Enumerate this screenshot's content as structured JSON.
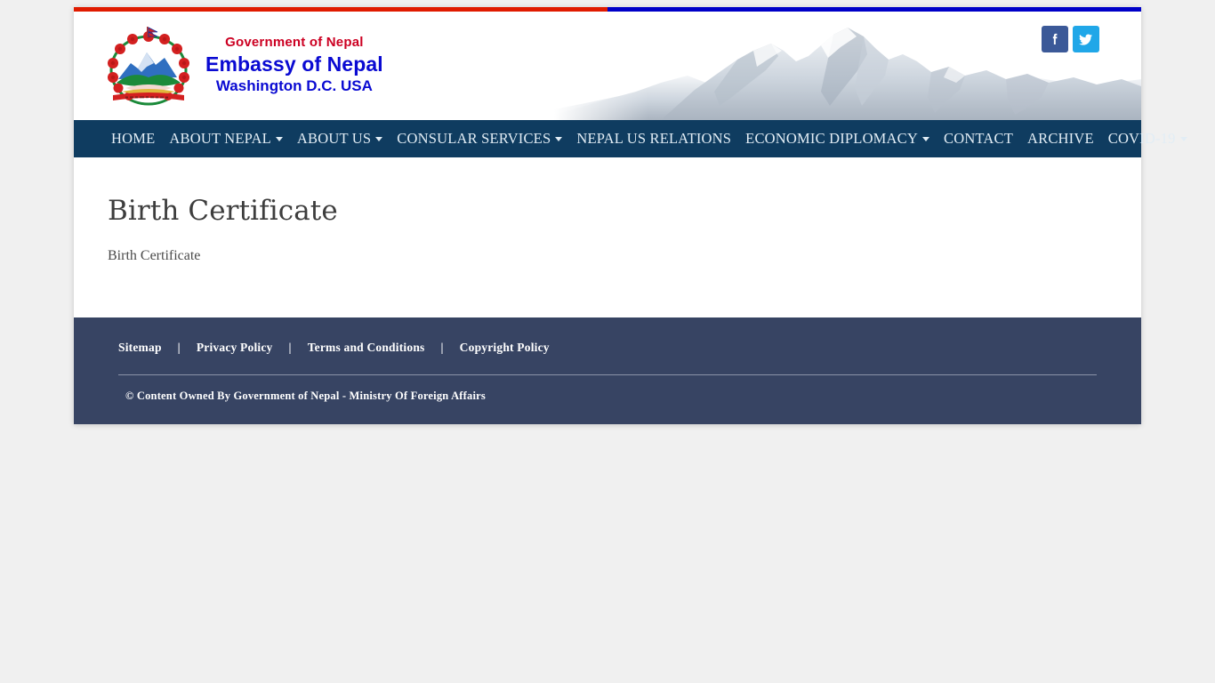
{
  "theme": {
    "stripe_red": "#e01b00",
    "stripe_blue": "#0000c8",
    "nav_bg": "#0f3c60",
    "nav_text": "#e2edf5",
    "footer_bg": "#374463",
    "brand_red": "#cc0022",
    "brand_blue": "#0a0ad2",
    "facebook_blue": "#3b5998",
    "twitter_blue": "#20a7e8",
    "page_bg": "#f0f0f0"
  },
  "header": {
    "emblem_alt": "coat-of-arms-of-nepal",
    "government_line": "Government of Nepal",
    "embassy_line": "Embassy of Nepal",
    "city_line": "Washington D.C. USA",
    "banner_image": "himalaya-mountains-panorama",
    "social": [
      {
        "name": "facebook",
        "icon": "facebook-icon",
        "label": "f"
      },
      {
        "name": "twitter",
        "icon": "twitter-icon",
        "label": "t"
      }
    ]
  },
  "nav": {
    "items": [
      {
        "label": "HOME",
        "has_dropdown": false
      },
      {
        "label": "ABOUT NEPAL",
        "has_dropdown": true
      },
      {
        "label": "ABOUT US",
        "has_dropdown": true
      },
      {
        "label": "CONSULAR SERVICES",
        "has_dropdown": true
      },
      {
        "label": "NEPAL US RELATIONS",
        "has_dropdown": false
      },
      {
        "label": "ECONOMIC DIPLOMACY",
        "has_dropdown": true
      },
      {
        "label": "CONTACT",
        "has_dropdown": false
      },
      {
        "label": "ARCHIVE",
        "has_dropdown": false
      },
      {
        "label": "COVID-19",
        "has_dropdown": true
      }
    ]
  },
  "main": {
    "title": "Birth Certificate",
    "body": "Birth Certificate"
  },
  "footer": {
    "links": [
      {
        "label": "Sitemap"
      },
      {
        "label": "Privacy Policy"
      },
      {
        "label": "Terms and Conditions"
      },
      {
        "label": "Copyright Policy"
      }
    ],
    "separator": "|",
    "copyright": "© Content Owned By Government of Nepal - Ministry Of Foreign Affairs"
  }
}
